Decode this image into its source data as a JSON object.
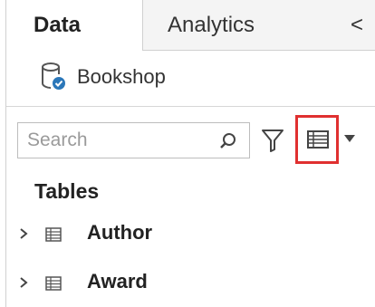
{
  "tabs": {
    "data_label": "Data",
    "analytics_label": "Analytics",
    "collapse_glyph": "<"
  },
  "datasource": {
    "name": "Bookshop",
    "icon": "database-connected-icon"
  },
  "search": {
    "placeholder": "Search",
    "value": ""
  },
  "toolbar": {
    "filter_icon": "filter-icon",
    "view_toggle_icon": "list-view-icon",
    "dropdown_icon": "caret-down-icon",
    "highlight_color": "#e03030"
  },
  "tables": {
    "heading": "Tables",
    "items": [
      {
        "name": "Author",
        "icon": "table-icon"
      },
      {
        "name": "Award",
        "icon": "table-icon"
      }
    ]
  },
  "colors": {
    "text": "#222222",
    "inactive_tab_bg": "#f4f4f4",
    "border": "#d0d0d0",
    "db_badge": "#2b77b9"
  }
}
